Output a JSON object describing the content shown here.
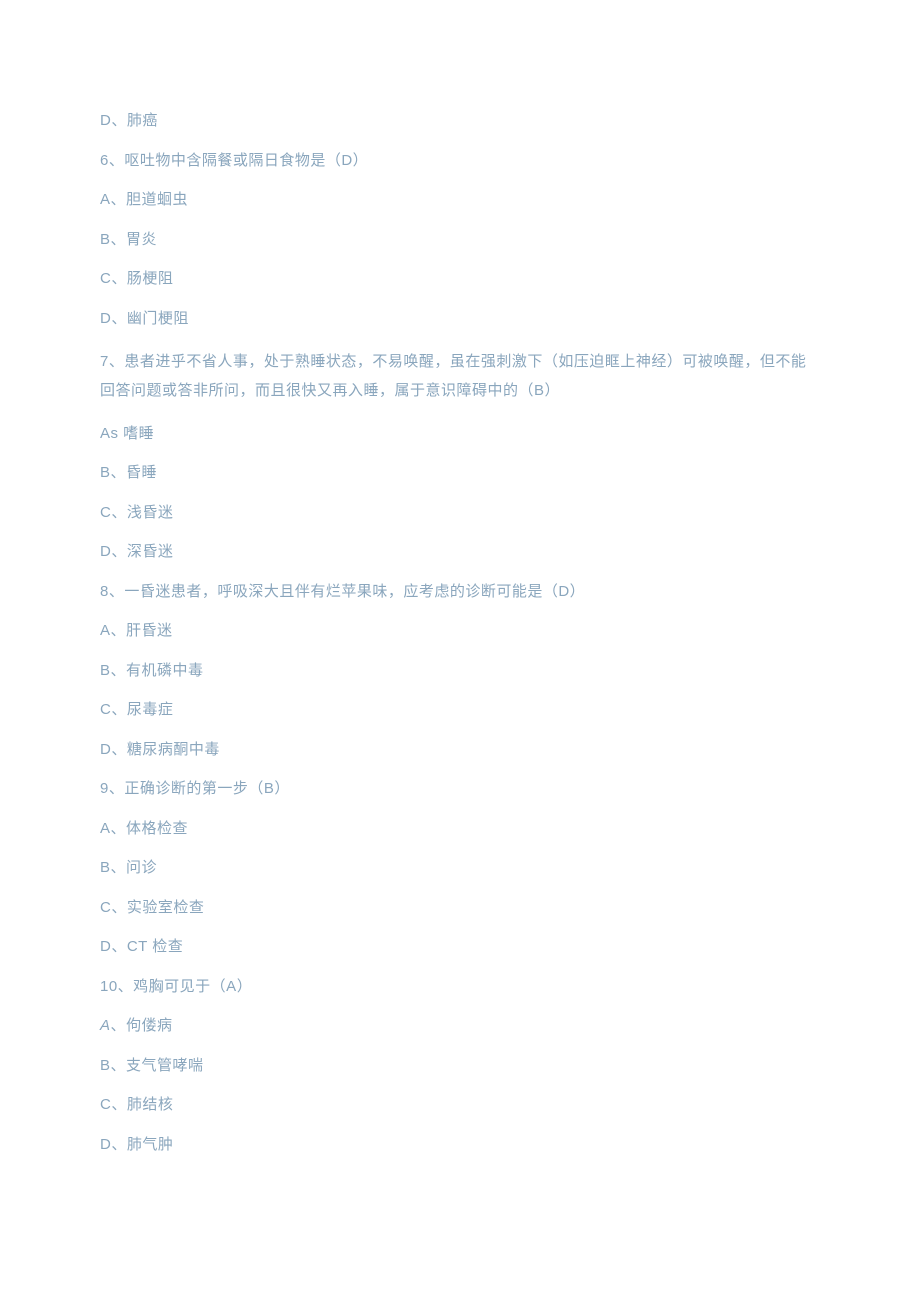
{
  "lines": [
    {
      "text": "D、肺癌",
      "cls": "line"
    },
    {
      "text": "6、呕吐物中含隔餐或隔日食物是（D）",
      "cls": "line"
    },
    {
      "text": "A、胆道蛔虫",
      "cls": "line"
    },
    {
      "text": "B、胃炎",
      "cls": "line"
    },
    {
      "text": "C、肠梗阻",
      "cls": "line"
    },
    {
      "text": "D、幽门梗阻",
      "cls": "line"
    },
    {
      "text": "7、患者进乎不省人事，处于熟睡状态，不易唤醒，虽在强刺激下（如压迫眶上神经）可被唤醒，但不能回答问题或答非所问，而且很快又再入睡，属于意识障碍中的（B）",
      "cls": "q"
    },
    {
      "text": "As 嗜睡",
      "cls": "line"
    },
    {
      "text": "B、昏睡",
      "cls": "line"
    },
    {
      "text": "C、浅昏迷",
      "cls": "line"
    },
    {
      "text": "D、深昏迷",
      "cls": "line"
    },
    {
      "text": "8、一昏迷患者，呼吸深大且伴有烂苹果味，应考虑的诊断可能是（D）",
      "cls": "line"
    },
    {
      "text": "A、肝昏迷",
      "cls": "line"
    },
    {
      "text": "B、有机磷中毒",
      "cls": "line"
    },
    {
      "text": "C、尿毒症",
      "cls": "line"
    },
    {
      "text": "D、糖尿病酮中毒",
      "cls": "line"
    },
    {
      "text": "9、正确诊断的第一步（B）",
      "cls": "line"
    },
    {
      "text": "A、体格检查",
      "cls": "line"
    },
    {
      "text": "B、问诊",
      "cls": "line"
    },
    {
      "text": "C、实验室检查",
      "cls": "line"
    },
    {
      "text": "D、CT 检查",
      "cls": "line"
    },
    {
      "text": "10、鸡胸可见于（A）",
      "cls": "line"
    },
    {
      "text": "A、佝偻病",
      "cls": "line italic",
      "prefix": "A",
      "rest": "、佝偻病"
    },
    {
      "text": "B、支气管哮喘",
      "cls": "line"
    },
    {
      "text": "C、肺结核",
      "cls": "line"
    },
    {
      "text": "D、肺气肿",
      "cls": "line"
    }
  ]
}
